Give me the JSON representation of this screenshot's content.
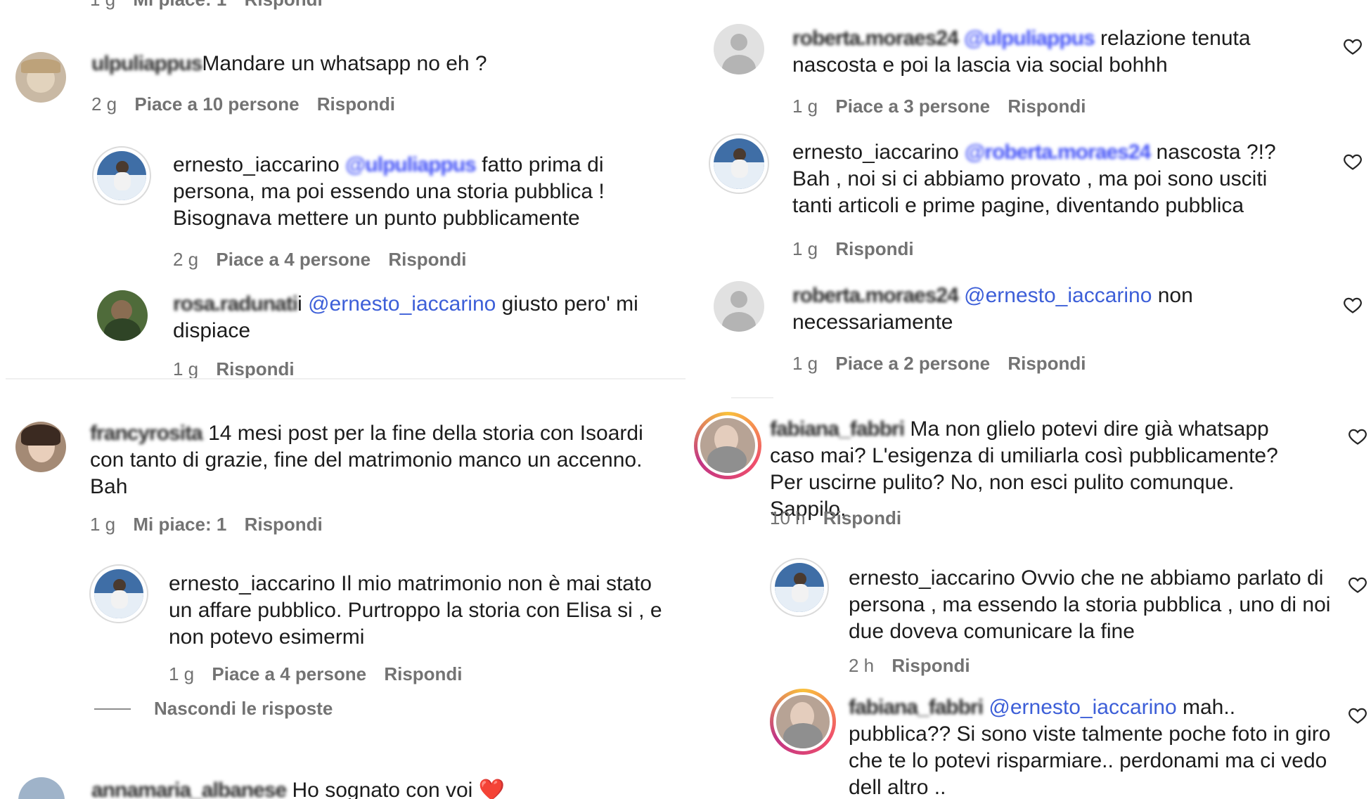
{
  "left": {
    "top_cut": {
      "time": "1 g",
      "likes": "Mi piace: 1",
      "reply": "Rispondi"
    },
    "c1": {
      "user": "ulpuliappus",
      "text": "Mandare un whatsapp no eh ?",
      "time": "2 g",
      "likes": "Piace a 10 persone",
      "reply": "Rispondi"
    },
    "c2": {
      "user": "ernesto_iaccarino",
      "mention": "@ulpuliappus",
      "text": " fatto prima di persona, ma poi essendo una storia pubblica ! Bisognava mettere un punto pubblicamente",
      "time": "2 g",
      "likes": "Piace a 4 persone",
      "reply": "Rispondi"
    },
    "c3": {
      "user": "rosa.radunati",
      "user_tail": "i",
      "mention": "@ernesto_iaccarino",
      "text": " giusto pero' mi dispiace",
      "time": "1 g",
      "reply": "Rispondi"
    },
    "c4": {
      "user": "francyrosita",
      "text": " 14 mesi post per la fine della storia con Isoardi con tanto di grazie, fine del matrimonio manco un accenno. Bah",
      "time": "1 g",
      "likes": "Mi piace: 1",
      "reply": "Rispondi"
    },
    "c5": {
      "user": "ernesto_iaccarino",
      "text": " Il mio matrimonio non è mai stato un affare pubblico. Purtroppo la storia con Elisa si , e non potevo esimermi",
      "time": "1 g",
      "likes": "Piace a 4 persone",
      "reply": "Rispondi"
    },
    "hide_replies": "Nascondi le risposte",
    "c6": {
      "user": "annamaria_albanese",
      "text": "Ho sognato con voi ",
      "emoji": "❤️"
    }
  },
  "right": {
    "r1": {
      "user": "roberta.moraes24",
      "mention": "@ulpuliappus",
      "text": " relazione tenuta nascosta e poi la lascia via social bohhh",
      "time": "1 g",
      "likes": "Piace a 3 persone",
      "reply": "Rispondi"
    },
    "r2": {
      "user": "ernesto_iaccarino",
      "mention": "@roberta.moraes24",
      "text": " nascosta ?!? Bah , noi si ci abbiamo provato , ma poi sono usciti tanti articoli e prime pagine, diventando pubblica",
      "time": "1 g",
      "reply": "Rispondi"
    },
    "r3": {
      "user": "roberta.moraes24",
      "mention": "@ernesto_iaccarino",
      "text": " non necessariamente",
      "time": "1 g",
      "likes": "Piace a 2 persone",
      "reply": "Rispondi"
    },
    "r4": {
      "user": "fabiana_fabbri",
      "text": " Ma non glielo potevi dire già whatsapp caso mai? L'esigenza di umiliarla così pubblicamente? Per uscirne pulito? No, non esci pulito comunque. Sappilo.",
      "time": "10 h",
      "reply": "Rispondi"
    },
    "r5": {
      "user": "ernesto_iaccarino",
      "text": " Ovvio che ne abbiamo parlato di persona , ma essendo la storia pubblica , uno di noi due doveva comunicare la fine",
      "time": "2 h",
      "reply": "Rispondi"
    },
    "r6": {
      "user": "fabiana_fabbri",
      "mention": "@ernesto_iaccarino",
      "text": " mah.. pubblica?? Si sono viste talmente poche foto in giro che te lo potevi risparmiare.. perdonami ma ci vedo dell altro .."
    }
  },
  "icons": {
    "heart": "heart-icon",
    "heart_color": "#262626"
  },
  "colors": {
    "mention": "#3d5fd8",
    "meta": "#737373",
    "text": "#1c1c1c"
  }
}
